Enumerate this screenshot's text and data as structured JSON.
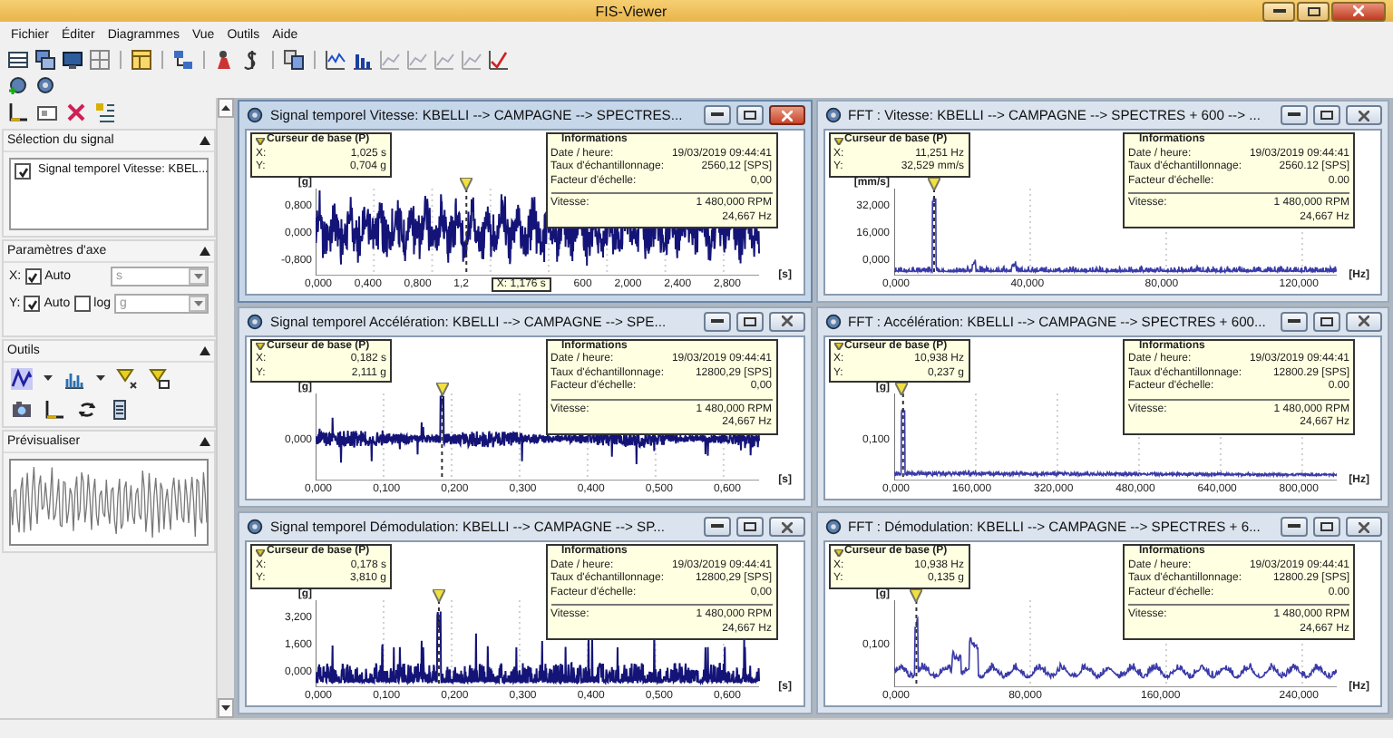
{
  "window": {
    "title": "FIS-Viewer"
  },
  "menu": [
    {
      "label": "Fichier"
    },
    {
      "label": "Éditer"
    },
    {
      "label": "Diagrammes"
    },
    {
      "label": "Vue"
    },
    {
      "label": "Outils"
    },
    {
      "label": "Aide"
    }
  ],
  "signal_selection": {
    "title": "Sélection du signal",
    "items": [
      {
        "label": "Signal temporel Vitesse: KBEL...",
        "checked": true
      }
    ]
  },
  "axis_params": {
    "title": "Paramètres d'axe",
    "rows": [
      {
        "axis": "X:",
        "auto": true,
        "auto_label": "Auto",
        "unit": "s"
      },
      {
        "axis": "Y:",
        "auto": true,
        "auto_label": "Auto",
        "log": false,
        "log_label": "log",
        "unit": "g"
      }
    ]
  },
  "tools": {
    "title": "Outils"
  },
  "preview": {
    "title": "Prévisualiser"
  },
  "windows": [
    {
      "kind": "time",
      "active": true,
      "title": "Signal temporel Vitesse: KBELLI --> CAMPAGNE --> SPECTRES...",
      "cursor": {
        "title": "Curseur de base (P)",
        "x_label": "X:",
        "x": "1,025 s",
        "y_label": "Y:",
        "y": "0,704 g"
      },
      "info": {
        "title": "Informations",
        "rows": [
          {
            "label": "Date / heure:",
            "value": "19/03/2019 09:44:41"
          },
          {
            "label": "Taux d'échantillonnage:",
            "value": "2560,12 [SPS]"
          },
          {
            "label": "Facteur d'échelle:",
            "value": "0,00"
          }
        ],
        "speed_label": "Vitesse:",
        "speed_values": [
          "1 480,000 RPM",
          "24,667 Hz"
        ]
      },
      "y_unit": "[g]",
      "y_ticks": [
        "0,800",
        "0,000",
        "-0,800"
      ],
      "x_unit": "[s]",
      "x_ticks": [
        "0,000",
        "0,400",
        "0,800",
        "1,2",
        "600",
        "2,000",
        "2,400",
        "2,800"
      ],
      "cursor_tooltip": "X: 1,176 s"
    },
    {
      "kind": "fft",
      "active": false,
      "title": "FFT : Vitesse: KBELLI --> CAMPAGNE --> SPECTRES + 600 --> ...",
      "cursor": {
        "title": "Curseur de base (P)",
        "x_label": "X:",
        "x": "11,251 Hz",
        "y_label": "Y:",
        "y": "32,529 mm/s"
      },
      "info": {
        "title": "Informations",
        "rows": [
          {
            "label": "Date / heure:",
            "value": "19/03/2019 09:44:41"
          },
          {
            "label": "Taux d'échantillonnage:",
            "value": "2560.12 [SPS]"
          },
          {
            "label": "Facteur d'échelle:",
            "value": "0.00"
          }
        ],
        "speed_label": "Vitesse:",
        "speed_values": [
          "1 480,000 RPM",
          "24,667 Hz"
        ]
      },
      "y_unit": "[mm/s]",
      "y_ticks": [
        "32,000",
        "16,000",
        "0,000"
      ],
      "x_unit": "[Hz]",
      "x_ticks": [
        "0,000",
        "40,000",
        "80,000",
        "120,000"
      ]
    },
    {
      "kind": "time",
      "active": false,
      "title": "Signal temporel Accélération: KBELLI --> CAMPAGNE --> SPE...",
      "cursor": {
        "title": "Curseur de base (P)",
        "x_label": "X:",
        "x": "0,182 s",
        "y_label": "Y:",
        "y": "2,111 g"
      },
      "info": {
        "title": "Informations",
        "rows": [
          {
            "label": "Date / heure:",
            "value": "19/03/2019 09:44:41"
          },
          {
            "label": "Taux d'échantillonnage:",
            "value": "12800,29 [SPS]"
          },
          {
            "label": "Facteur d'échelle:",
            "value": "0,00"
          }
        ],
        "speed_label": "Vitesse:",
        "speed_values": [
          "1 480,000 RPM",
          "24,667 Hz"
        ]
      },
      "y_unit": "[g]",
      "y_ticks": [
        "0,000"
      ],
      "x_unit": "[s]",
      "x_ticks": [
        "0,000",
        "0,100",
        "0,200",
        "0,300",
        "0,400",
        "0,500",
        "0,600"
      ]
    },
    {
      "kind": "fft",
      "active": false,
      "title": "FFT : Accélération: KBELLI --> CAMPAGNE --> SPECTRES + 600...",
      "cursor": {
        "title": "Curseur de base (P)",
        "x_label": "X:",
        "x": "10,938 Hz",
        "y_label": "Y:",
        "y": "0,237 g"
      },
      "info": {
        "title": "Informations",
        "rows": [
          {
            "label": "Date / heure:",
            "value": "19/03/2019 09:44:41"
          },
          {
            "label": "Taux d'échantillonnage:",
            "value": "12800.29 [SPS]"
          },
          {
            "label": "Facteur d'échelle:",
            "value": "0.00"
          }
        ],
        "speed_label": "Vitesse:",
        "speed_values": [
          "1 480,000 RPM",
          "24,667 Hz"
        ]
      },
      "y_unit": "[g]",
      "y_ticks": [
        "0,100"
      ],
      "x_unit": "[Hz]",
      "x_ticks": [
        "0,000",
        "160,000",
        "320,000",
        "480,000",
        "640,000",
        "800,000"
      ]
    },
    {
      "kind": "time",
      "active": false,
      "title": "Signal temporel Démodulation: KBELLI --> CAMPAGNE --> SP...",
      "cursor": {
        "title": "Curseur de base (P)",
        "x_label": "X:",
        "x": "0,178 s",
        "y_label": "Y:",
        "y": "3,810 g"
      },
      "info": {
        "title": "Informations",
        "rows": [
          {
            "label": "Date / heure:",
            "value": "19/03/2019 09:44:41"
          },
          {
            "label": "Taux d'échantillonnage:",
            "value": "12800,29 [SPS]"
          },
          {
            "label": "Facteur d'échelle:",
            "value": "0,00"
          }
        ],
        "speed_label": "Vitesse:",
        "speed_values": [
          "1 480,000 RPM",
          "24,667 Hz"
        ]
      },
      "y_unit": "[g]",
      "y_ticks": [
        "3,200",
        "1,600",
        "0,000"
      ],
      "x_unit": "[s]",
      "x_ticks": [
        "0,000",
        "0,100",
        "0,200",
        "0,300",
        "0,400",
        "0,500",
        "0,600"
      ]
    },
    {
      "kind": "fft",
      "active": false,
      "title": "FFT : Démodulation: KBELLI --> CAMPAGNE --> SPECTRES + 6...",
      "cursor": {
        "title": "Curseur de base (P)",
        "x_label": "X:",
        "x": "10,938 Hz",
        "y_label": "Y:",
        "y": "0,135 g"
      },
      "info": {
        "title": "Informations",
        "rows": [
          {
            "label": "Date / heure:",
            "value": "19/03/2019 09:44:41"
          },
          {
            "label": "Taux d'échantillonnage:",
            "value": "12800.29 [SPS]"
          },
          {
            "label": "Facteur d'échelle:",
            "value": "0.00"
          }
        ],
        "speed_label": "Vitesse:",
        "speed_values": [
          "1 480,000 RPM",
          "24,667 Hz"
        ]
      },
      "y_unit": "[g]",
      "y_ticks": [
        "0,100"
      ],
      "x_unit": "[Hz]",
      "x_ticks": [
        "0,000",
        "80,000",
        "160,000",
        "240,000"
      ]
    }
  ]
}
